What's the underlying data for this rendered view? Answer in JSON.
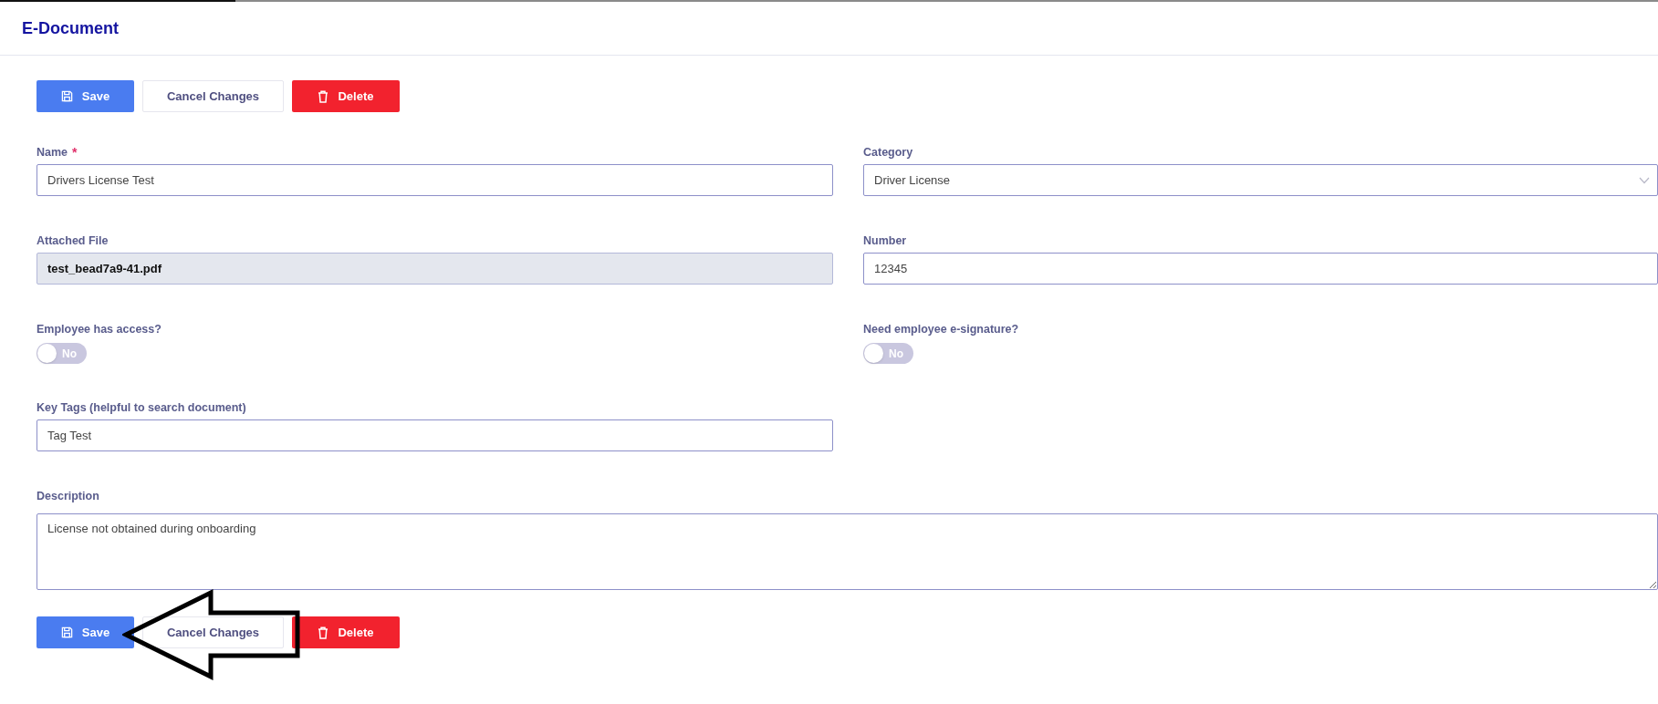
{
  "loading_bar": {
    "level": 0.142
  },
  "header": {
    "title": "E-Document"
  },
  "top_actions": [
    {
      "kind": "save",
      "label": "Save"
    },
    {
      "kind": "cancel",
      "label": "Cancel Changes"
    },
    {
      "kind": "delete",
      "label": "Delete"
    }
  ],
  "fields": [
    {
      "kind": "text",
      "label": "Name",
      "required_mark": "*",
      "value": "Drivers License Test"
    },
    {
      "kind": "select",
      "label": "Category",
      "value": "Driver License"
    },
    {
      "kind": "file",
      "label": "Attached File",
      "value": "test_bead7a9-41.pdf"
    },
    {
      "kind": "text",
      "label": "Number",
      "value": "12345"
    },
    {
      "kind": "toggle",
      "label": "Employee has access?",
      "on": false,
      "state_text": "No"
    },
    {
      "kind": "toggle",
      "label": "Need employee e-signature?",
      "on": false,
      "state_text": "No"
    },
    {
      "kind": "text",
      "label": "Key Tags (helpful to search document)",
      "value": "Tag Test"
    },
    {
      "kind": "textarea",
      "label": "Description",
      "value": "License not obtained during onboarding"
    }
  ],
  "bottom_actions": [
    {
      "kind": "save",
      "label": "Save"
    },
    {
      "kind": "cancel",
      "label": "Cancel Changes"
    },
    {
      "kind": "delete",
      "label": "Delete"
    }
  ],
  "annotation": {
    "kind": "arrow"
  }
}
